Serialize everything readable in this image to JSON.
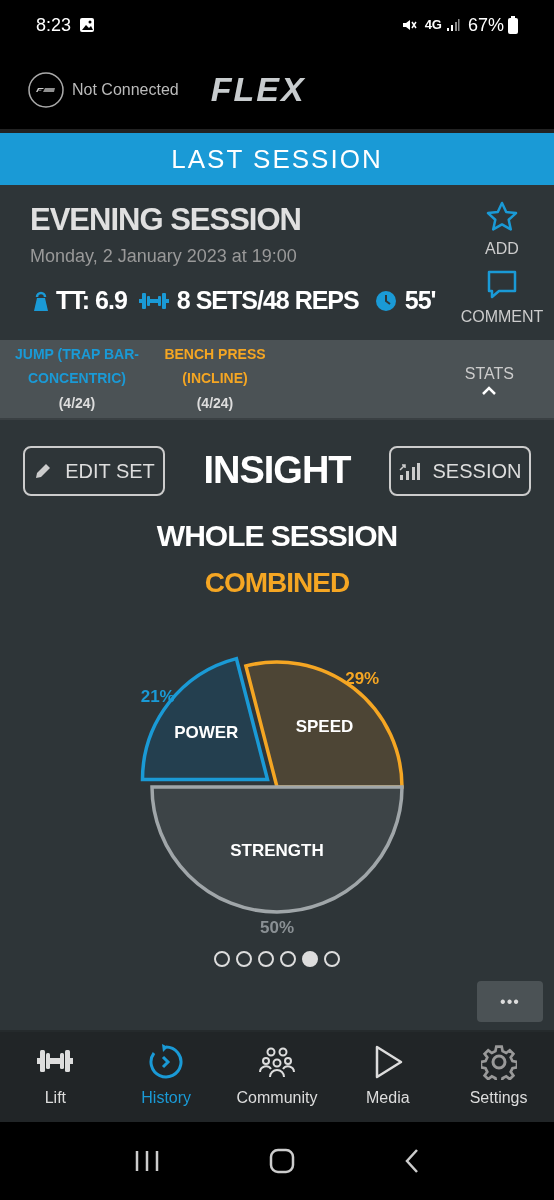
{
  "status_bar": {
    "time": "8:23",
    "network": "4G",
    "battery": "67%"
  },
  "header": {
    "connection": "Not Connected",
    "logo": "FLEX"
  },
  "section_title": "LAST SESSION",
  "session": {
    "title": "EVENING SESSION",
    "date": "Monday, 2 January 2023 at 19:00",
    "tt": "TT: 6.9",
    "sets": "8 SETS/48 REPS",
    "duration": "55'",
    "actions": [
      {
        "kind": "star",
        "label": "ADD"
      },
      {
        "kind": "comment",
        "label": "COMMENT"
      }
    ]
  },
  "exercises": [
    {
      "name": "JUMP (TRAP BAR-CONCENTRIC)",
      "count": "(4/24)",
      "color": "#1a9ad6"
    },
    {
      "name": "BENCH PRESS (INCLINE)",
      "count": "(4/24)",
      "color": "#f5a623"
    }
  ],
  "stats_label": "STATS",
  "insight": {
    "edit_button": "EDIT SET",
    "title": "INSIGHT",
    "session_button": "SESSION",
    "subtitle": "WHOLE SESSION",
    "mode": "COMBINED",
    "chart_data": {
      "type": "pie",
      "categories": [
        "POWER",
        "SPEED",
        "STRENGTH"
      ],
      "values": [
        21,
        29,
        50
      ],
      "value_labels": [
        "21%",
        "29%",
        "50%"
      ]
    },
    "pages": [
      {
        "selected": false
      },
      {
        "selected": false
      },
      {
        "selected": false
      },
      {
        "selected": false
      },
      {
        "selected": true
      },
      {
        "selected": false
      }
    ]
  },
  "more_button": "•••",
  "nav": [
    {
      "kind": "lift",
      "label": "Lift",
      "selected": false
    },
    {
      "kind": "history",
      "label": "History",
      "selected": true
    },
    {
      "kind": "community",
      "label": "Community",
      "selected": false
    },
    {
      "kind": "media",
      "label": "Media",
      "selected": false
    },
    {
      "kind": "settings",
      "label": "Settings",
      "selected": false
    }
  ]
}
